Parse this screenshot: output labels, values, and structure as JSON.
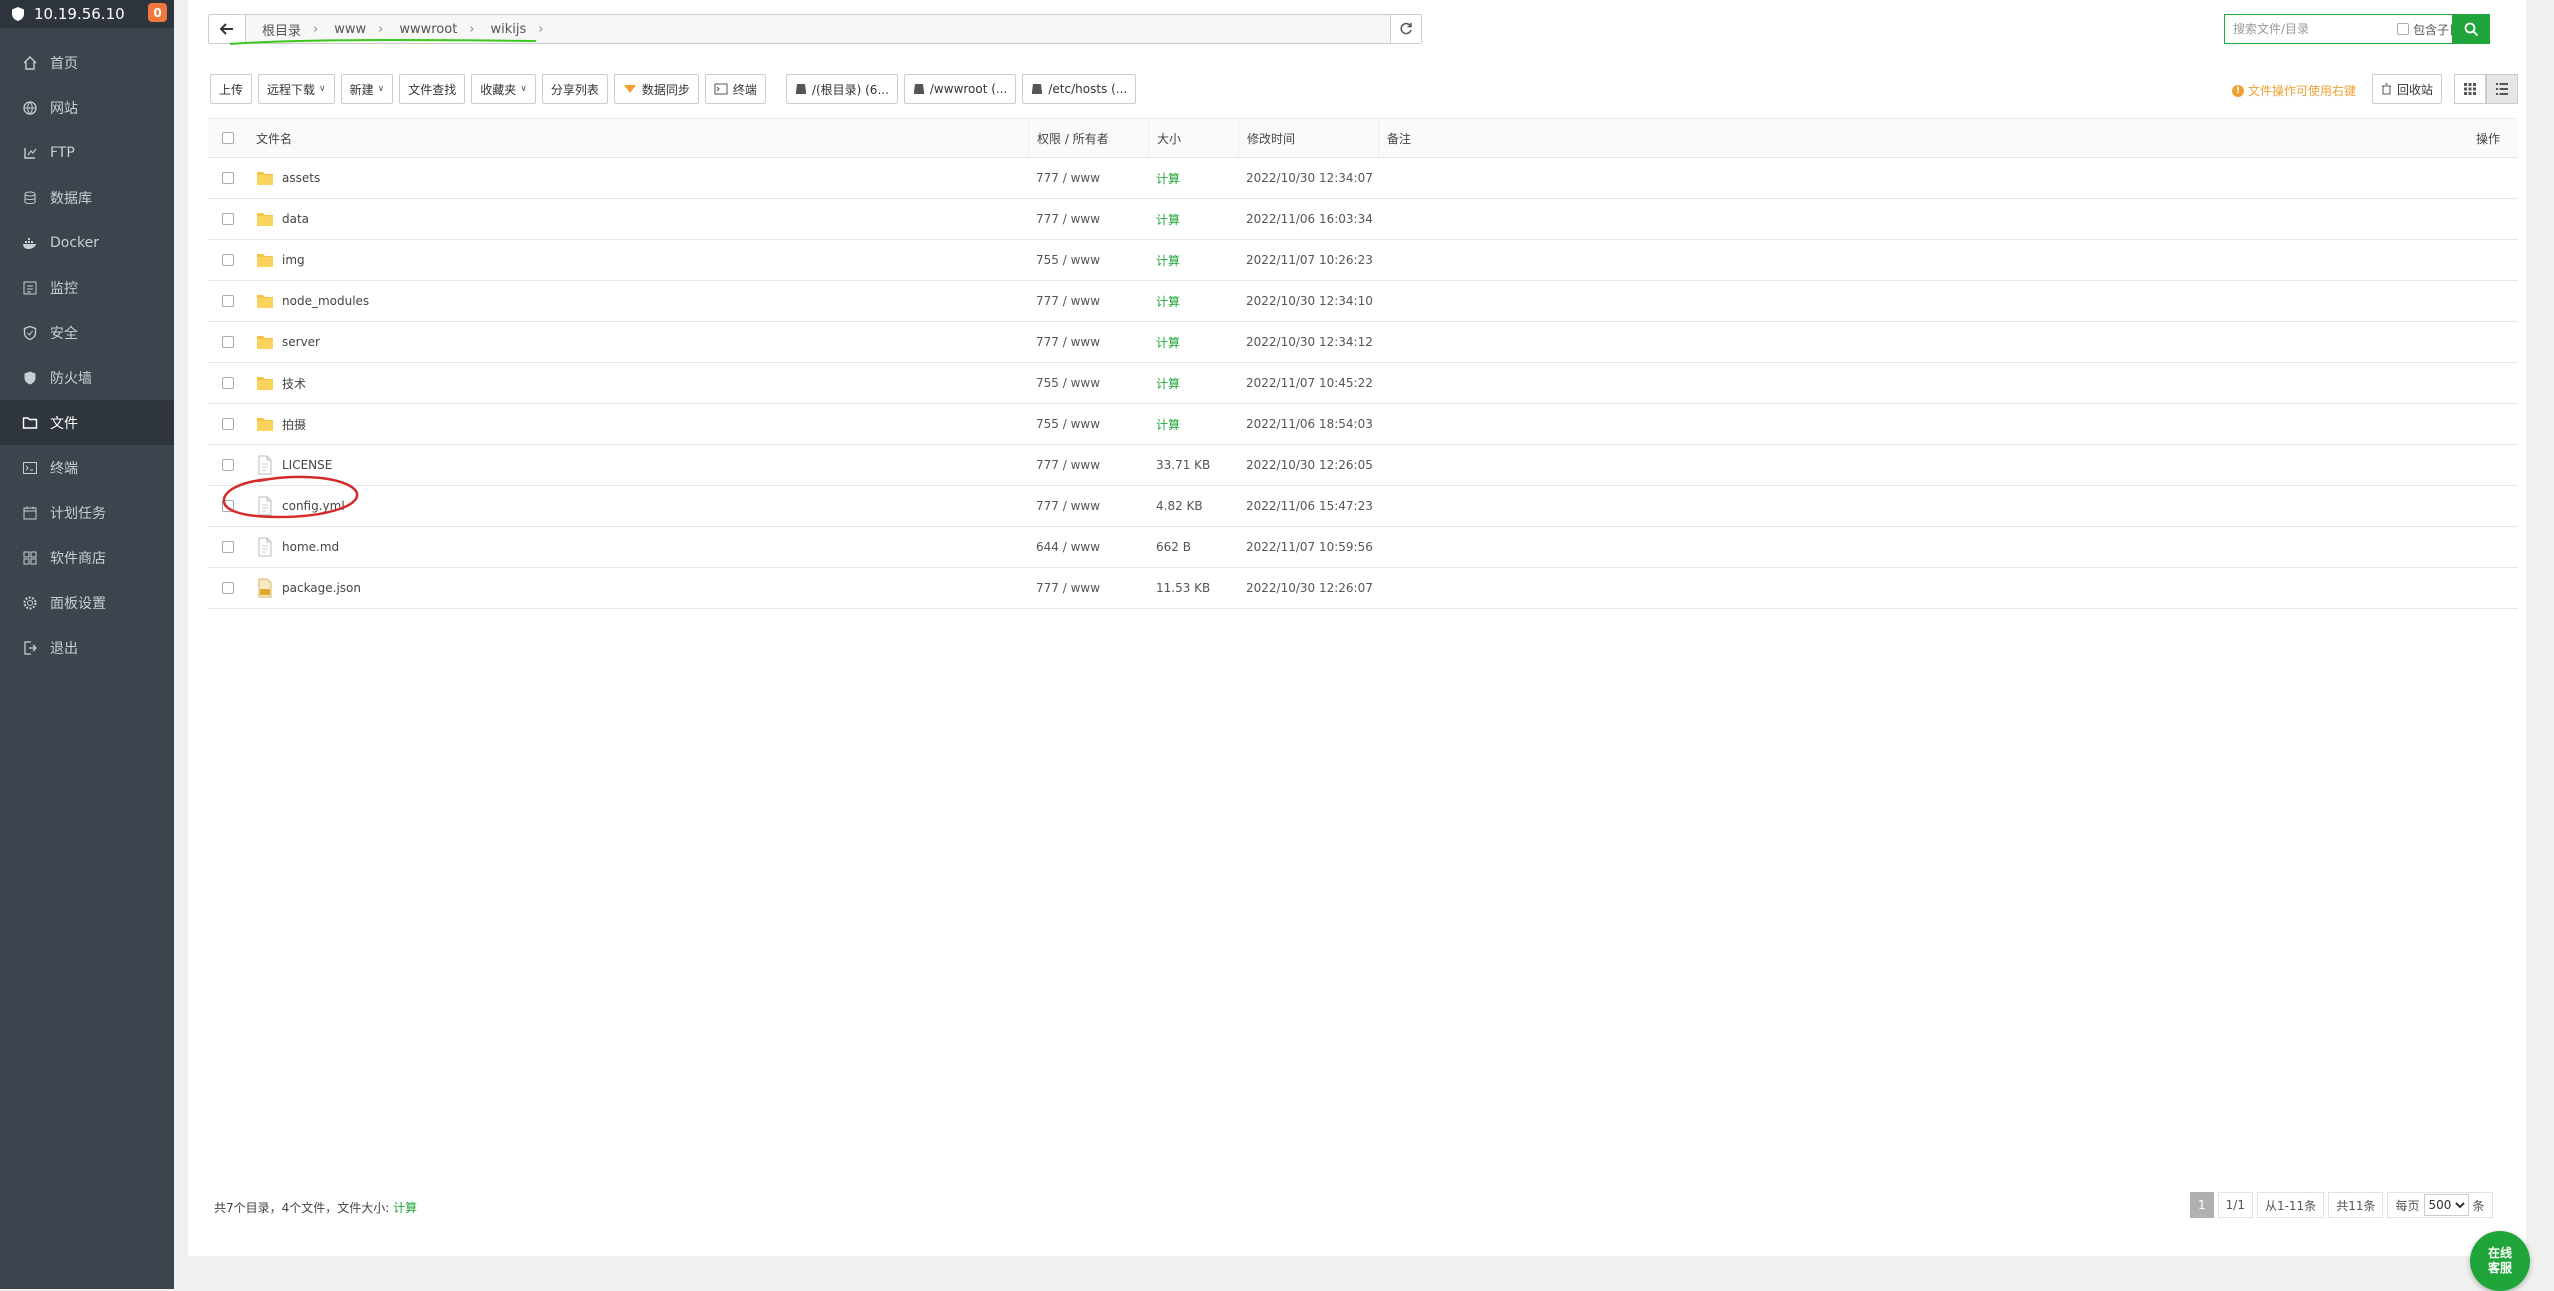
{
  "sidebar": {
    "host": "10.19.56.10",
    "badge": "0",
    "items": [
      {
        "label": "首页",
        "icon": "home-icon"
      },
      {
        "label": "网站",
        "icon": "globe-icon"
      },
      {
        "label": "FTP",
        "icon": "ftp-icon"
      },
      {
        "label": "数据库",
        "icon": "database-icon"
      },
      {
        "label": "Docker",
        "icon": "docker-icon"
      },
      {
        "label": "监控",
        "icon": "monitor-icon"
      },
      {
        "label": "安全",
        "icon": "shield-icon"
      },
      {
        "label": "防火墙",
        "icon": "firewall-icon"
      },
      {
        "label": "文件",
        "icon": "folder-icon",
        "active": true
      },
      {
        "label": "终端",
        "icon": "terminal-icon"
      },
      {
        "label": "计划任务",
        "icon": "calendar-icon"
      },
      {
        "label": "软件商店",
        "icon": "apps-icon"
      },
      {
        "label": "面板设置",
        "icon": "gear-icon"
      },
      {
        "label": "退出",
        "icon": "logout-icon"
      }
    ]
  },
  "path": {
    "crumbs": [
      "根目录",
      "www",
      "wwwroot",
      "wikijs"
    ]
  },
  "search": {
    "placeholder": "搜索文件/目录",
    "subdir_label": "包含子目录"
  },
  "toolbar": {
    "upload": "上传",
    "remote_download": "远程下载",
    "new": "新建",
    "find_content": "文件查找",
    "favorites": "收藏夹",
    "share_list": "分享列表",
    "data_sync": "数据同步",
    "terminal": "终端",
    "disk1": "/(根目录) (6...",
    "disk2": "/wwwroot (...",
    "disk3": "/etc/hosts (...",
    "tip": "文件操作可使用右键",
    "recycle": "回收站"
  },
  "table": {
    "headers": {
      "name": "文件名",
      "perm": "权限 / 所有者",
      "size": "大小",
      "mtime": "修改时间",
      "note": "备注",
      "op": "操作"
    },
    "rows": [
      {
        "name": "assets",
        "type": "folder",
        "perm": "777 / www",
        "size": "计算",
        "mtime": "2022/10/30 12:34:07"
      },
      {
        "name": "data",
        "type": "folder",
        "perm": "777 / www",
        "size": "计算",
        "mtime": "2022/11/06 16:03:34"
      },
      {
        "name": "img",
        "type": "folder",
        "perm": "755 / www",
        "size": "计算",
        "mtime": "2022/11/07 10:26:23"
      },
      {
        "name": "node_modules",
        "type": "folder",
        "perm": "777 / www",
        "size": "计算",
        "mtime": "2022/10/30 12:34:10"
      },
      {
        "name": "server",
        "type": "folder",
        "perm": "777 / www",
        "size": "计算",
        "mtime": "2022/10/30 12:34:12"
      },
      {
        "name": "技术",
        "type": "folder",
        "perm": "755 / www",
        "size": "计算",
        "mtime": "2022/11/07 10:45:22"
      },
      {
        "name": "拍摄",
        "type": "folder",
        "perm": "755 / www",
        "size": "计算",
        "mtime": "2022/11/06 18:54:03"
      },
      {
        "name": "LICENSE",
        "type": "file",
        "perm": "777 / www",
        "size": "33.71 KB",
        "mtime": "2022/10/30 12:26:05"
      },
      {
        "name": "config.yml",
        "type": "file",
        "perm": "777 / www",
        "size": "4.82 KB",
        "mtime": "2022/11/06 15:47:23"
      },
      {
        "name": "home.md",
        "type": "file",
        "perm": "644 / www",
        "size": "662 B",
        "mtime": "2022/11/07 10:59:56"
      },
      {
        "name": "package.json",
        "type": "json",
        "perm": "777 / www",
        "size": "11.53 KB",
        "mtime": "2022/10/30 12:26:07"
      }
    ]
  },
  "footer": {
    "summary_prefix": "共7个目录，4个文件，文件大小:",
    "summary_calc": "计算",
    "page_current": "1",
    "page_total": "1/1",
    "range": "从1-11条",
    "total": "共11条",
    "per_page_label": "每页",
    "per_page_value": "500",
    "per_page_unit": "条"
  },
  "online_service": "在线客服",
  "colors": {
    "accent": "#20a53a",
    "sidebar": "#3c444d",
    "warning": "#f0a030",
    "annotation_red": "#d42a2a",
    "annotation_green": "#3cc81e"
  }
}
